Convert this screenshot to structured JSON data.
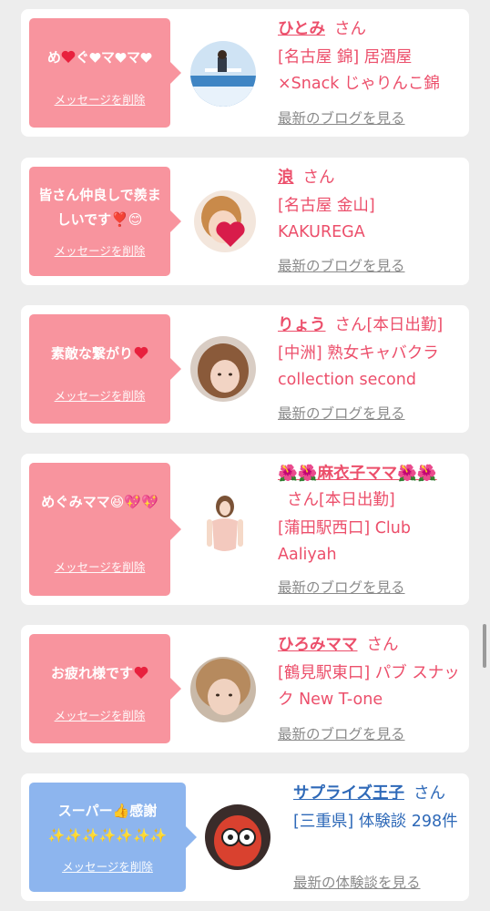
{
  "cards": [
    {
      "message_parts": [
        "め",
        "ぐ",
        "マ",
        "マ"
      ],
      "message_suffix": "",
      "delete_label": "メッセージを削除",
      "name": "ひとみ",
      "honorific": "さん",
      "status": "",
      "shop": "[名古屋 錦] 居酒屋×Snack じゃりんこ錦",
      "link_label": "最新のブログを見る",
      "theme": "pink"
    },
    {
      "message_text": "皆さん仲良しで羨ましいです❣️😊",
      "delete_label": "メッセージを削除",
      "name": "浪",
      "honorific": "さん",
      "status": "",
      "shop": "[名古屋 金山] KAKUREGA",
      "link_label": "最新のブログを見る",
      "theme": "pink"
    },
    {
      "message_text": "素敵な繋がり",
      "delete_label": "メッセージを削除",
      "name": "りょう",
      "honorific": "さん",
      "status": "[本日出勤]",
      "shop": "[中洲] 熟女キャバクラ collection second",
      "link_label": "最新のブログを見る",
      "theme": "pink"
    },
    {
      "message_text": "めぐみママ😆💖💖",
      "delete_label": "メッセージを削除",
      "name": "🌺🌺麻衣子ママ🌺🌺",
      "honorific": "さん",
      "status": "[本日出勤]",
      "shop": "[蒲田駅西口] Club Aaliyah",
      "link_label": "最新のブログを見る",
      "theme": "pink"
    },
    {
      "message_text": "お疲れ様です",
      "delete_label": "メッセージを削除",
      "name": "ひろみママ",
      "honorific": "さん",
      "status": "",
      "shop": "[鶴見駅東口] パブ スナック New T-one",
      "link_label": "最新のブログを見る",
      "theme": "pink"
    },
    {
      "message_text": "スーパー👍感謝✨✨✨✨✨✨✨",
      "delete_label": "メッセージを削除",
      "name": "サプライズ王子",
      "honorific": "さん",
      "status": "",
      "shop": "[三重県] 体験談 298件",
      "link_label": "最新の体験談を見る",
      "theme": "blue"
    }
  ],
  "colors": {
    "page_bg": "#ededed",
    "pink_bubble": "#f8949e",
    "blue_bubble": "#8db5ee",
    "pink_text": "#ec4f6b",
    "blue_text": "#2e69b8",
    "link_gray": "#8a8a8a"
  }
}
